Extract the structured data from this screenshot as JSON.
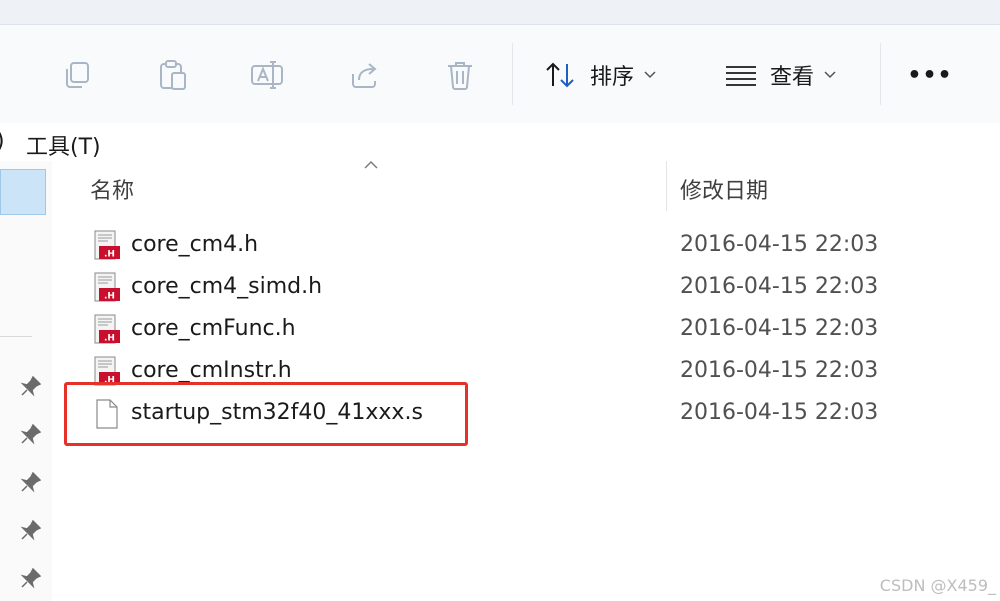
{
  "toolbar": {
    "sort_label": "排序",
    "view_label": "查看",
    "more_label": "•••",
    "icons": [
      "copy-icon",
      "paste-icon",
      "rename-icon",
      "share-icon",
      "delete-icon",
      "sort-icon",
      "view-icon",
      "more-icon"
    ]
  },
  "menubar": {
    "partial_label": ")",
    "tools_label": "工具(T)"
  },
  "columns": {
    "name": "名称",
    "date": "修改日期"
  },
  "files": [
    {
      "name": "core_cm4.h",
      "date": "2016-04-15 22:03",
      "type": "h"
    },
    {
      "name": "core_cm4_simd.h",
      "date": "2016-04-15 22:03",
      "type": "h"
    },
    {
      "name": "core_cmFunc.h",
      "date": "2016-04-15 22:03",
      "type": "h"
    },
    {
      "name": "core_cmInstr.h",
      "date": "2016-04-15 22:03",
      "type": "h"
    },
    {
      "name": "startup_stm32f40_41xxx.s",
      "date": "2016-04-15 22:03",
      "type": "s"
    }
  ],
  "watermark": "CSDN @X459_",
  "colors": {
    "highlight": "#e8302a",
    "selection": "#cce4f7",
    "header_icon_red": "#c8102e",
    "accent_blue": "#1f5fbf"
  }
}
